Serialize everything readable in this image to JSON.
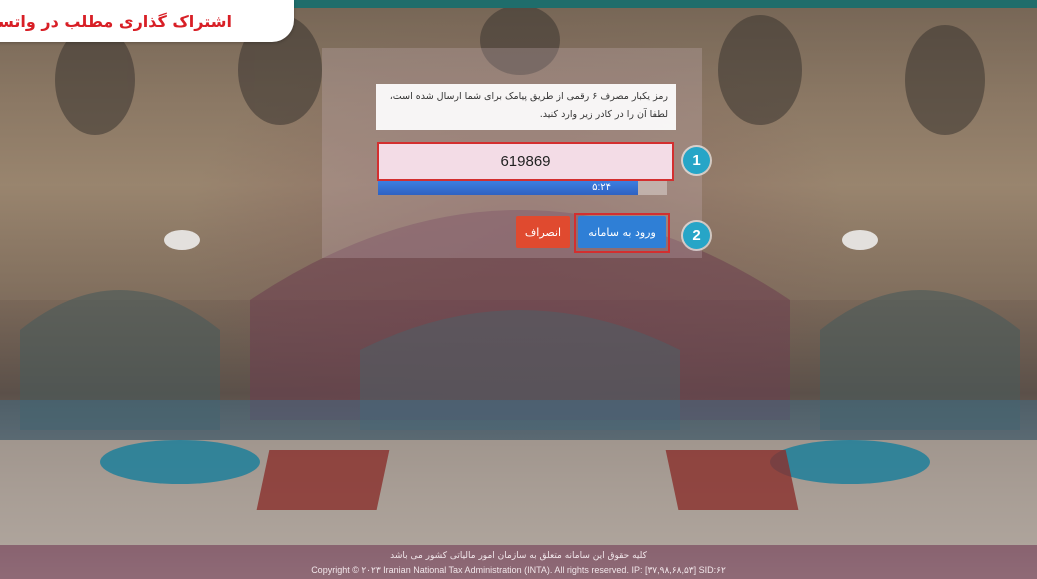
{
  "share_banner": {
    "text": "اشتراک گذاری مطلب در واتساپ"
  },
  "otp": {
    "message_line1": "رمز یکبار مصرف ۶ رقمی از طریق پیامک برای شما ارسال شده است،",
    "message_line2": "لطفا آن را در کادر زیر وارد کنید.",
    "code_value": "619869",
    "timer_text": "۵:۲۴",
    "timer_progress_percent": 90
  },
  "steps": {
    "one": "1",
    "two": "2"
  },
  "buttons": {
    "login_label": "ورود به سامانه",
    "cancel_label": "انصراف"
  },
  "footer": {
    "line_fa": "کلیه حقوق این سامانه متعلق به سازمان امور مالیاتی کشور می باشد",
    "line_en": "Copyright © ۲۰۲۳ Iranian National Tax Administration (INTA). All rights reserved. IP: [۳۷,۹۸,۶۸,۵۳] SID:۶۲"
  },
  "colors": {
    "accent_blue": "#2f7fd6",
    "cancel_red": "#e04a2f",
    "highlight_red": "#d32f2f",
    "step_badge": "#27a5c7",
    "share_text": "#d81f26"
  },
  "icons": {
    "background": "bathhouse-photo"
  }
}
